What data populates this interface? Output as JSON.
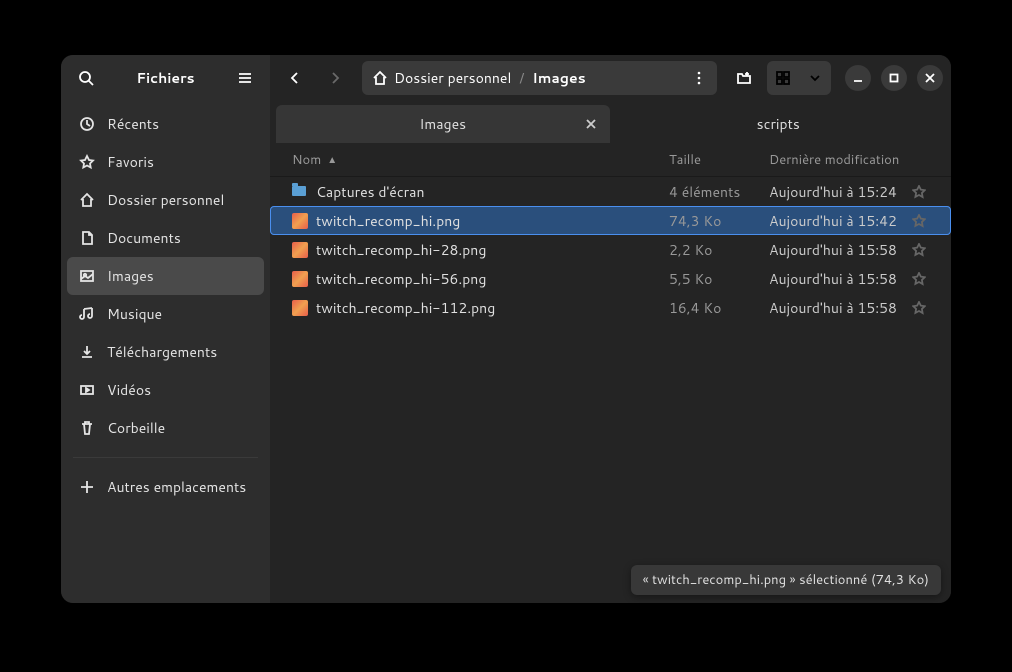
{
  "app_title": "Fichiers",
  "breadcrumb": {
    "root": "Dossier personnel",
    "current": "Images"
  },
  "tabs": [
    {
      "label": "Images",
      "active": true,
      "closable": true
    },
    {
      "label": "scripts",
      "active": false
    }
  ],
  "columns": {
    "name": "Nom",
    "size": "Taille",
    "modified": "Dernière modification"
  },
  "sidebar": {
    "items": [
      {
        "icon": "clock",
        "label": "Récents"
      },
      {
        "icon": "star",
        "label": "Favoris"
      },
      {
        "icon": "home",
        "label": "Dossier personnel"
      },
      {
        "icon": "doc",
        "label": "Documents"
      },
      {
        "icon": "image",
        "label": "Images",
        "active": true
      },
      {
        "icon": "music",
        "label": "Musique"
      },
      {
        "icon": "download",
        "label": "Téléchargements"
      },
      {
        "icon": "video",
        "label": "Vidéos"
      },
      {
        "icon": "trash",
        "label": "Corbeille"
      }
    ],
    "other": {
      "icon": "plus",
      "label": "Autres emplacements"
    }
  },
  "files": [
    {
      "type": "folder",
      "name": "Captures d'écran",
      "size": "4 éléments",
      "modified": "Aujourd'hui à 15:24"
    },
    {
      "type": "image",
      "name": "twitch_recomp_hi.png",
      "size": "74,3 Ko",
      "modified": "Aujourd'hui à 15:42",
      "selected": true
    },
    {
      "type": "image",
      "name": "twitch_recomp_hi-28.png",
      "size": "2,2 Ko",
      "modified": "Aujourd'hui à 15:58"
    },
    {
      "type": "image",
      "name": "twitch_recomp_hi-56.png",
      "size": "5,5 Ko",
      "modified": "Aujourd'hui à 15:58"
    },
    {
      "type": "image",
      "name": "twitch_recomp_hi-112.png",
      "size": "16,4 Ko",
      "modified": "Aujourd'hui à 15:58"
    }
  ],
  "status": {
    "prefix": "« ",
    "name": "twitch_recomp_hi.png",
    "mid": " » sélectionné  (",
    "size": "74,3 Ko",
    "suffix": ")"
  }
}
